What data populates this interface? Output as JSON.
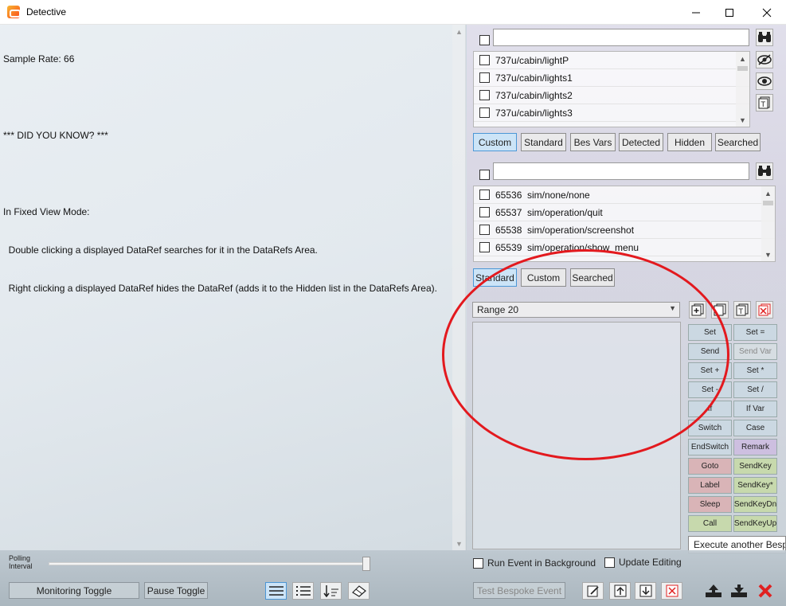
{
  "window": {
    "title": "Detective",
    "minimize_icon": "minimize-icon",
    "maximize_icon": "maximize-icon",
    "close_icon": "close-icon"
  },
  "info_text": {
    "lines": [
      "Sample Rate: 66",
      "",
      "*** DID YOU KNOW? ***",
      "",
      "In Fixed View Mode:",
      "  Double clicking a displayed DataRef searches for it in the DataRefs Area.",
      "  Right clicking a displayed DataRef hides the DataRef (adds it to the Hidden list in the DataRefs Area)."
    ]
  },
  "datarefs_panel": {
    "search_value": "",
    "items": [
      {
        "label": "737u/cabin/lightP"
      },
      {
        "label": "737u/cabin/lights1"
      },
      {
        "label": "737u/cabin/lights2"
      },
      {
        "label": "737u/cabin/lights3"
      }
    ],
    "tabs": [
      {
        "label": "Custom",
        "active": true
      },
      {
        "label": "Standard",
        "active": false
      },
      {
        "label": "Bes Vars",
        "active": false
      },
      {
        "label": "Detected",
        "active": false
      },
      {
        "label": "Hidden",
        "active": false
      },
      {
        "label": "Searched",
        "active": false
      }
    ],
    "icons": [
      "binoculars-icon",
      "eye-slash-icon",
      "eye-icon",
      "text-doc-icon"
    ]
  },
  "commands_panel": {
    "search_value": "",
    "items": [
      {
        "num": "65536",
        "label": "sim/none/none"
      },
      {
        "num": "65537",
        "label": "sim/operation/quit"
      },
      {
        "num": "65538",
        "label": "sim/operation/screenshot"
      },
      {
        "num": "65539",
        "label": "sim/operation/show_menu"
      }
    ],
    "tabs": [
      {
        "label": "Standard",
        "active": true
      },
      {
        "label": "Custom",
        "active": false
      },
      {
        "label": "Searched",
        "active": false
      }
    ]
  },
  "events_panel": {
    "selected_event": "Range 20",
    "icons": [
      "add-icon",
      "copy-icon",
      "text-doc-icon",
      "delete-icon"
    ],
    "commands": [
      [
        "Set",
        "Set ="
      ],
      [
        "Send",
        "Send Var"
      ],
      [
        "Set +",
        "Set *"
      ],
      [
        "Set -",
        "Set /"
      ],
      [
        "If",
        "If Var"
      ],
      [
        "Switch",
        "Case"
      ],
      [
        "EndSwitch",
        "Remark"
      ],
      [
        "Goto",
        "SendKey"
      ],
      [
        "Label",
        "SendKey*"
      ],
      [
        "Sleep",
        "SendKeyDn"
      ],
      [
        "Call",
        "SendKeyUp"
      ]
    ],
    "tooltip": "Execute another Bespoke Event",
    "run_in_background_label": "Run Event in Background",
    "update_editing_label": "Update Editing",
    "test_button_label": "Test Bespoke Event"
  },
  "bottom_bar": {
    "polling_label_line1": "Polling",
    "polling_label_line2": "Interval",
    "polling_value": 1.0,
    "monitoring_toggle_label": "Monitoring Toggle",
    "pause_toggle_label": "Pause Toggle"
  },
  "accent_colors": {
    "active_tab": "#cce4f7",
    "annotation": "#e3191e",
    "delete": "#e02020"
  }
}
